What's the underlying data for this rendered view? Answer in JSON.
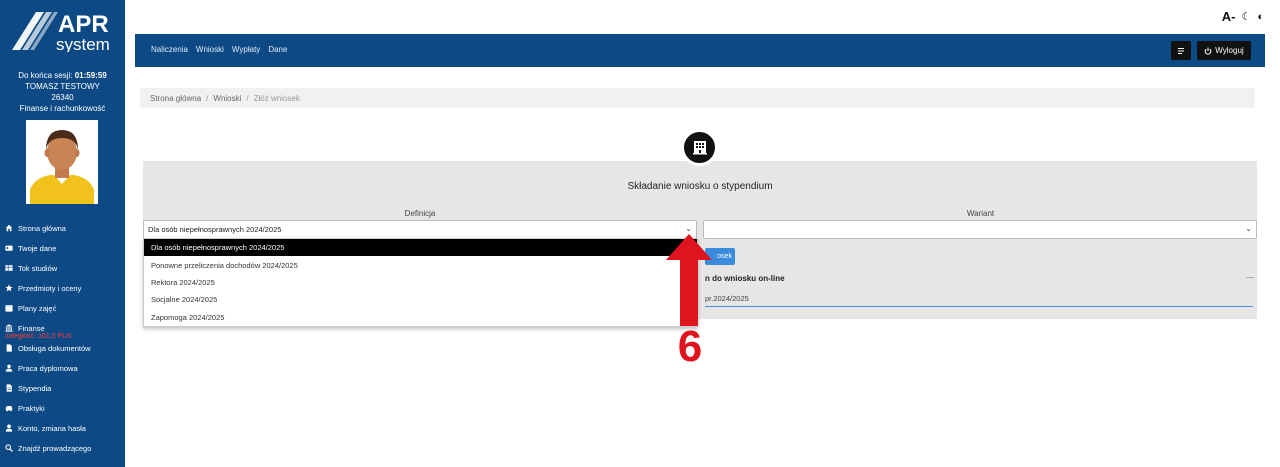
{
  "brand": {
    "line1": "APR",
    "line2": "system"
  },
  "session": {
    "label": "Do końca sesji:",
    "timer": "01:59:59",
    "user_name": "TOMASZ TESTOWY",
    "user_id": "26340",
    "department": "Finanse i rachunkowość"
  },
  "sidebar": {
    "items": [
      {
        "label": "Strona główna",
        "icon": "home-icon"
      },
      {
        "label": "Twoje dane",
        "icon": "id-card-icon"
      },
      {
        "label": "Tok studiów",
        "icon": "table-icon"
      },
      {
        "label": "Przedmioty i oceny",
        "icon": "star-icon"
      },
      {
        "label": "Plany zajęć",
        "icon": "calendar-icon"
      },
      {
        "label": "Finanse",
        "icon": "bank-icon",
        "note": "zaległość: 101,5 PLN"
      },
      {
        "label": "Obsługa dokumentów",
        "icon": "document-icon"
      },
      {
        "label": "Praca dyplomowa",
        "icon": "user-tie-icon"
      },
      {
        "label": "Stypendia",
        "icon": "file-icon"
      },
      {
        "label": "Praktyki",
        "icon": "car-icon"
      },
      {
        "label": "Konto, zmiana hasła",
        "icon": "user-icon"
      },
      {
        "label": "Znajdź prowadzącego",
        "icon": "search-icon"
      }
    ]
  },
  "top_controls": {
    "font_size": "A-",
    "dark_mode": "☾",
    "contrast": "◐"
  },
  "topbar": {
    "menu": [
      "Naliczenia",
      "Wnioski",
      "Wypłaty",
      "Dane"
    ],
    "logout_label": "Wyloguj"
  },
  "breadcrumb": {
    "home": "Strona główna",
    "section": "Wnioski",
    "current": "Złóż wniosek"
  },
  "form": {
    "title": "Składanie wniosku o stypendium",
    "definition_label": "Definicja",
    "variant_label": "Wariant",
    "definition_value": "Dla osób niepełnosprawnych 2024/2025",
    "variant_value": "",
    "button_label": "Dodaj wniosek",
    "button_visible": "osek",
    "section_title": "Dostęp do wniosku on-line",
    "section_visible": "n do wniosku on-line",
    "section_value_visible": "pr.2024/2025"
  },
  "dropdown": {
    "options": [
      "Dla osób niepełnosprawnych 2024/2025",
      "Ponowne przeliczenia dochodów 2024/2025",
      "Rektora 2024/2025",
      "Socjalne 2024/2025",
      "Zapomoga 2024/2025"
    ],
    "selected_index": 0
  },
  "annotation": {
    "step": "6",
    "color": "#e0141e"
  },
  "colors": {
    "primary": "#0d4a85",
    "accent": "#3b8bdc",
    "annotation": "#e0141e"
  }
}
